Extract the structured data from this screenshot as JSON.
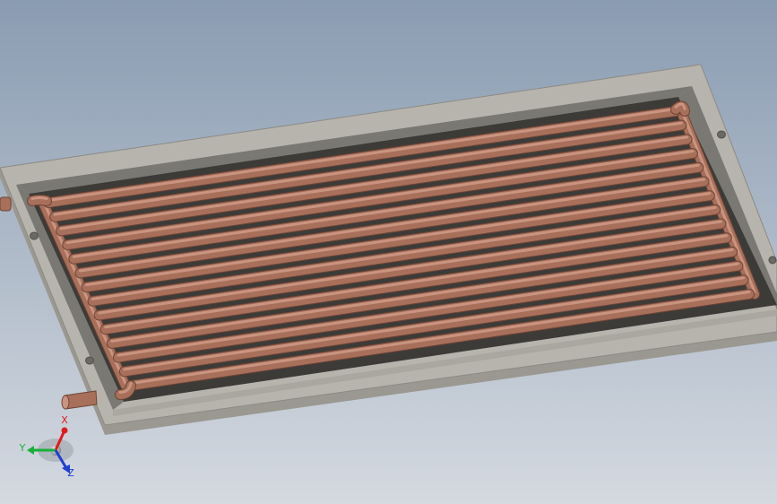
{
  "viewport": {
    "background_top": "#8a9cb2",
    "background_bottom": "#d4d9e0"
  },
  "model": {
    "tube_count": 14,
    "colors": {
      "frame_top": "#b7b4ad",
      "frame_outer_side": "#9a9891",
      "frame_inner_wall": "#7a7873",
      "frame_lip": "#a9a7a0",
      "cavity_floor": "#3c3b38",
      "tube": "#a8705b",
      "tube_highlight": "#c99480",
      "tube_shadow": "#6e4436",
      "hole": "#6a6964"
    }
  },
  "triad": {
    "x_label": "X",
    "y_label": "Y",
    "z_label": "Z",
    "x_color": "#e01b1b",
    "y_color": "#18b03a",
    "z_color": "#1f3fd1"
  }
}
